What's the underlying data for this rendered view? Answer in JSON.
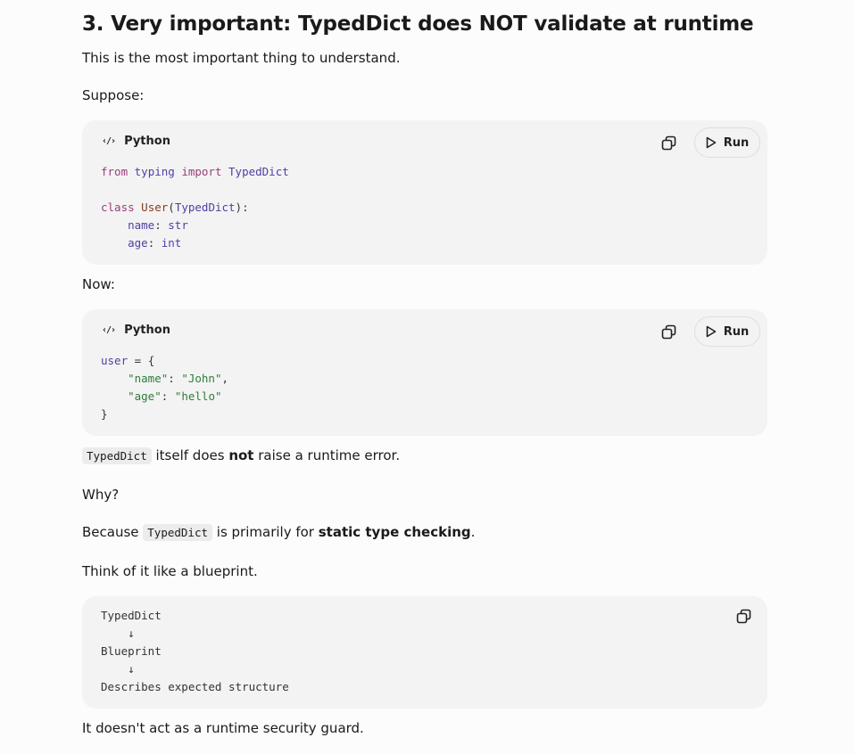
{
  "heading": "3. Very important: TypedDict does NOT validate at runtime",
  "intro": "This is the most important thing to understand.",
  "suppose": "Suppose:",
  "now": "Now:",
  "code_block_1": {
    "language": "Python",
    "run_label": "Run",
    "line1": {
      "kw1": "from",
      "mod": "typing",
      "kw2": "import",
      "name": "TypedDict"
    },
    "line3": {
      "kw": "class",
      "cls": "User",
      "open": "(",
      "base": "TypedDict",
      "close": "):"
    },
    "line4": {
      "field": "name",
      "colon": ":",
      "type": "str"
    },
    "line5": {
      "field": "age",
      "colon": ":",
      "type": "int"
    }
  },
  "code_block_2": {
    "language": "Python",
    "run_label": "Run",
    "line1": {
      "var": "user",
      "op": "=",
      "brace": "{"
    },
    "line2": {
      "key": "\"name\"",
      "colon": ":",
      "val": "\"John\"",
      "comma": ","
    },
    "line3": {
      "key": "\"age\"",
      "colon": ":",
      "val": "\"hello\""
    },
    "line4": "}"
  },
  "para_typeddict": {
    "code": "TypedDict",
    "text1": " itself does ",
    "bold": "not",
    "text2": " raise a runtime error."
  },
  "why": "Why?",
  "because": {
    "text1": "Because ",
    "code": "TypedDict",
    "text2": " is primarily for ",
    "bold": "static type checking",
    "text3": "."
  },
  "blueprint_intro": "Think of it like a blueprint.",
  "code_block_3": {
    "lines": [
      "TypedDict",
      "    ↓",
      "Blueprint",
      "    ↓",
      "Describes expected structure"
    ]
  },
  "closing": "It doesn't act as a runtime security guard.",
  "icons": {
    "lang": "code-icon",
    "copy": "copy-icon",
    "run": "play-icon"
  }
}
